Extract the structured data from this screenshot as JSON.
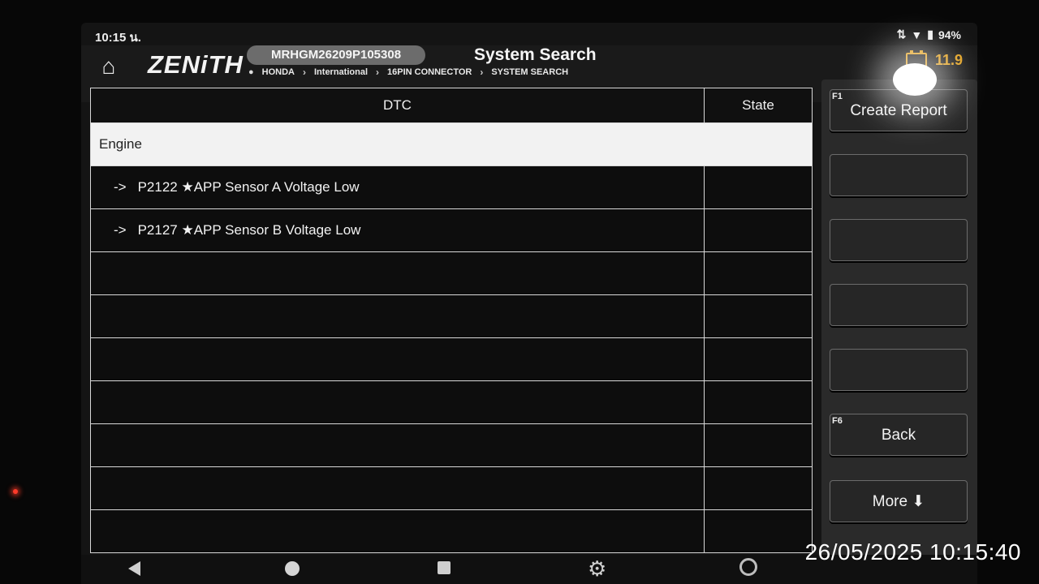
{
  "status": {
    "time": "10:15 น.",
    "battery_percent": "94%"
  },
  "header": {
    "logo": "ZENiTH",
    "vin": "MRHGM26209P105308",
    "title": "System Search",
    "breadcrumb": [
      "HONDA",
      "International",
      "16PIN CONNECTOR",
      "SYSTEM SEARCH"
    ],
    "vehicle_voltage": "11.9",
    "voltage_color": "#e0a020"
  },
  "table": {
    "columns": {
      "dtc": "DTC",
      "state": "State"
    },
    "group": "Engine",
    "rows": [
      {
        "code": "P2122 ★APP Sensor A Voltage Low",
        "state": ""
      },
      {
        "code": "P2127 ★APP Sensor B Voltage Low",
        "state": ""
      }
    ]
  },
  "buttons": {
    "f1_key": "F1",
    "f1_label": "Create Report",
    "f2_label": "",
    "f3_label": "",
    "f4_label": "",
    "f5_label": "",
    "f6_key": "F6",
    "f6_label": "Back",
    "more_label": "More ⬇"
  },
  "overlay": {
    "timestamp": "26/05/2025 10:15:40"
  }
}
